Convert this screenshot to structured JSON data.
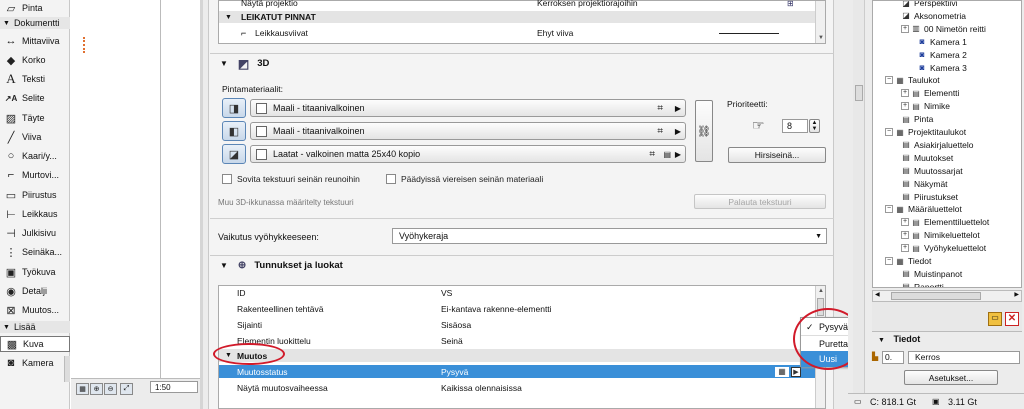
{
  "toolbox": {
    "top_item": "Pinta",
    "section_dokumentti": "Dokumentti",
    "items": [
      "Mittaviiva",
      "Korko",
      "Teksti",
      "Selite",
      "Täyte",
      "Viiva",
      "Kaari/y...",
      "Murtovi...",
      "Piirustus",
      "Leikkaus",
      "Julkisivu",
      "Seinäka...",
      "Työkuva",
      "Detalji",
      "Muutos..."
    ],
    "section_lisaa": "Lisää",
    "lisaa_items": [
      "Kuva",
      "Kamera"
    ],
    "icons": [
      "surface-icon",
      "dimension-icon",
      "level-icon",
      "text-icon",
      "label-icon",
      "fill-icon",
      "line-icon",
      "arc-icon",
      "polyline-icon",
      "drawing-icon",
      "section-icon",
      "elevation-icon",
      "wall-elevation-icon",
      "worksheet-icon",
      "detail-icon",
      "change-icon",
      "picture-icon",
      "camera-icon"
    ]
  },
  "canvas": {
    "scale": "1:50"
  },
  "dialog": {
    "top_rows": [
      {
        "label": "Näytä projektio",
        "value": "Kerroksen projektiorajoihin"
      },
      {
        "label": "LEIKATUT PINNAT",
        "value": ""
      },
      {
        "label": "Leikkausviivat",
        "value": "Ehyt viiva"
      }
    ],
    "section_3d": "3D",
    "surface_label": "Pintamateriaalit:",
    "materials": [
      "Maali - titaanivalkoinen",
      "Maali - titaanivalkoinen",
      "Laatat - valkoinen matta 25x40 kopio"
    ],
    "priority_label": "Prioriteetti:",
    "priority_value": "8",
    "hirsi_button": "Hirsiseinä...",
    "checkbox_fit": "Sovita tekstuuri seinän reunoihin",
    "checkbox_ends": "Päädyissä viereisen seinän materiaali",
    "texture_note": "Muu 3D-ikkunassa määritelty tekstuuri",
    "restore_button": "Palauta tekstuuri",
    "zone_label": "Vaikutus vyöhykkeeseen:",
    "zone_value": "Vyöhykeraja",
    "section_ids": "Tunnukset ja luokat",
    "properties": [
      {
        "key": "ID",
        "value": "VS"
      },
      {
        "key": "Rakenteellinen tehtävä",
        "value": "Ei-kantava rakenne-elementti"
      },
      {
        "key": "Sijainti",
        "value": "Sisäosa"
      },
      {
        "key": "Elementin luokittelu",
        "value": "Seinä"
      }
    ],
    "section_muutos": "Muutos",
    "change_rows": [
      {
        "key": "Muutosstatus",
        "value": "Pysyvä"
      },
      {
        "key": "Näytä muutosvaiheessa",
        "value": "Kaikissa olennaisissa"
      }
    ]
  },
  "popup": {
    "items": [
      "Pysyvä",
      "Purettava",
      "Uusi"
    ],
    "checked": "Pysyvä",
    "highlighted": "Uusi"
  },
  "navigator": {
    "nodes": [
      {
        "label": "Perspektiivi",
        "indent": 3
      },
      {
        "label": "Aksonometria",
        "indent": 3
      },
      {
        "label": "00 Nimetön reitti",
        "indent": 3
      },
      {
        "label": "Kamera 1",
        "indent": 5
      },
      {
        "label": "Kamera 2",
        "indent": 5
      },
      {
        "label": "Kamera 3",
        "indent": 5
      },
      {
        "label": "Taulukot",
        "indent": 1
      },
      {
        "label": "Elementti",
        "indent": 3
      },
      {
        "label": "Nimike",
        "indent": 3
      },
      {
        "label": "Pinta",
        "indent": 3
      },
      {
        "label": "Projektitaulukot",
        "indent": 1
      },
      {
        "label": "Asiakirjaluettelo",
        "indent": 3
      },
      {
        "label": "Muutokset",
        "indent": 3
      },
      {
        "label": "Muutossarjat",
        "indent": 3
      },
      {
        "label": "Näkymät",
        "indent": 3
      },
      {
        "label": "Piirustukset",
        "indent": 3
      },
      {
        "label": "Määräluettelot",
        "indent": 1
      },
      {
        "label": "Elementtiluettelot",
        "indent": 3
      },
      {
        "label": "Nimikeluettelot",
        "indent": 3
      },
      {
        "label": "Vyöhykeluettelot",
        "indent": 3
      },
      {
        "label": "Tiedot",
        "indent": 1
      },
      {
        "label": "Muistinpanot",
        "indent": 3
      },
      {
        "label": "Raportti",
        "indent": 3
      }
    ],
    "tiedot_header": "Tiedot",
    "floor_value": "0.",
    "floor_label": "Kerros",
    "settings_button": "Asetukset...",
    "status_c": "C: 818.1 Gt",
    "status_mem": "3.11 Gt"
  }
}
